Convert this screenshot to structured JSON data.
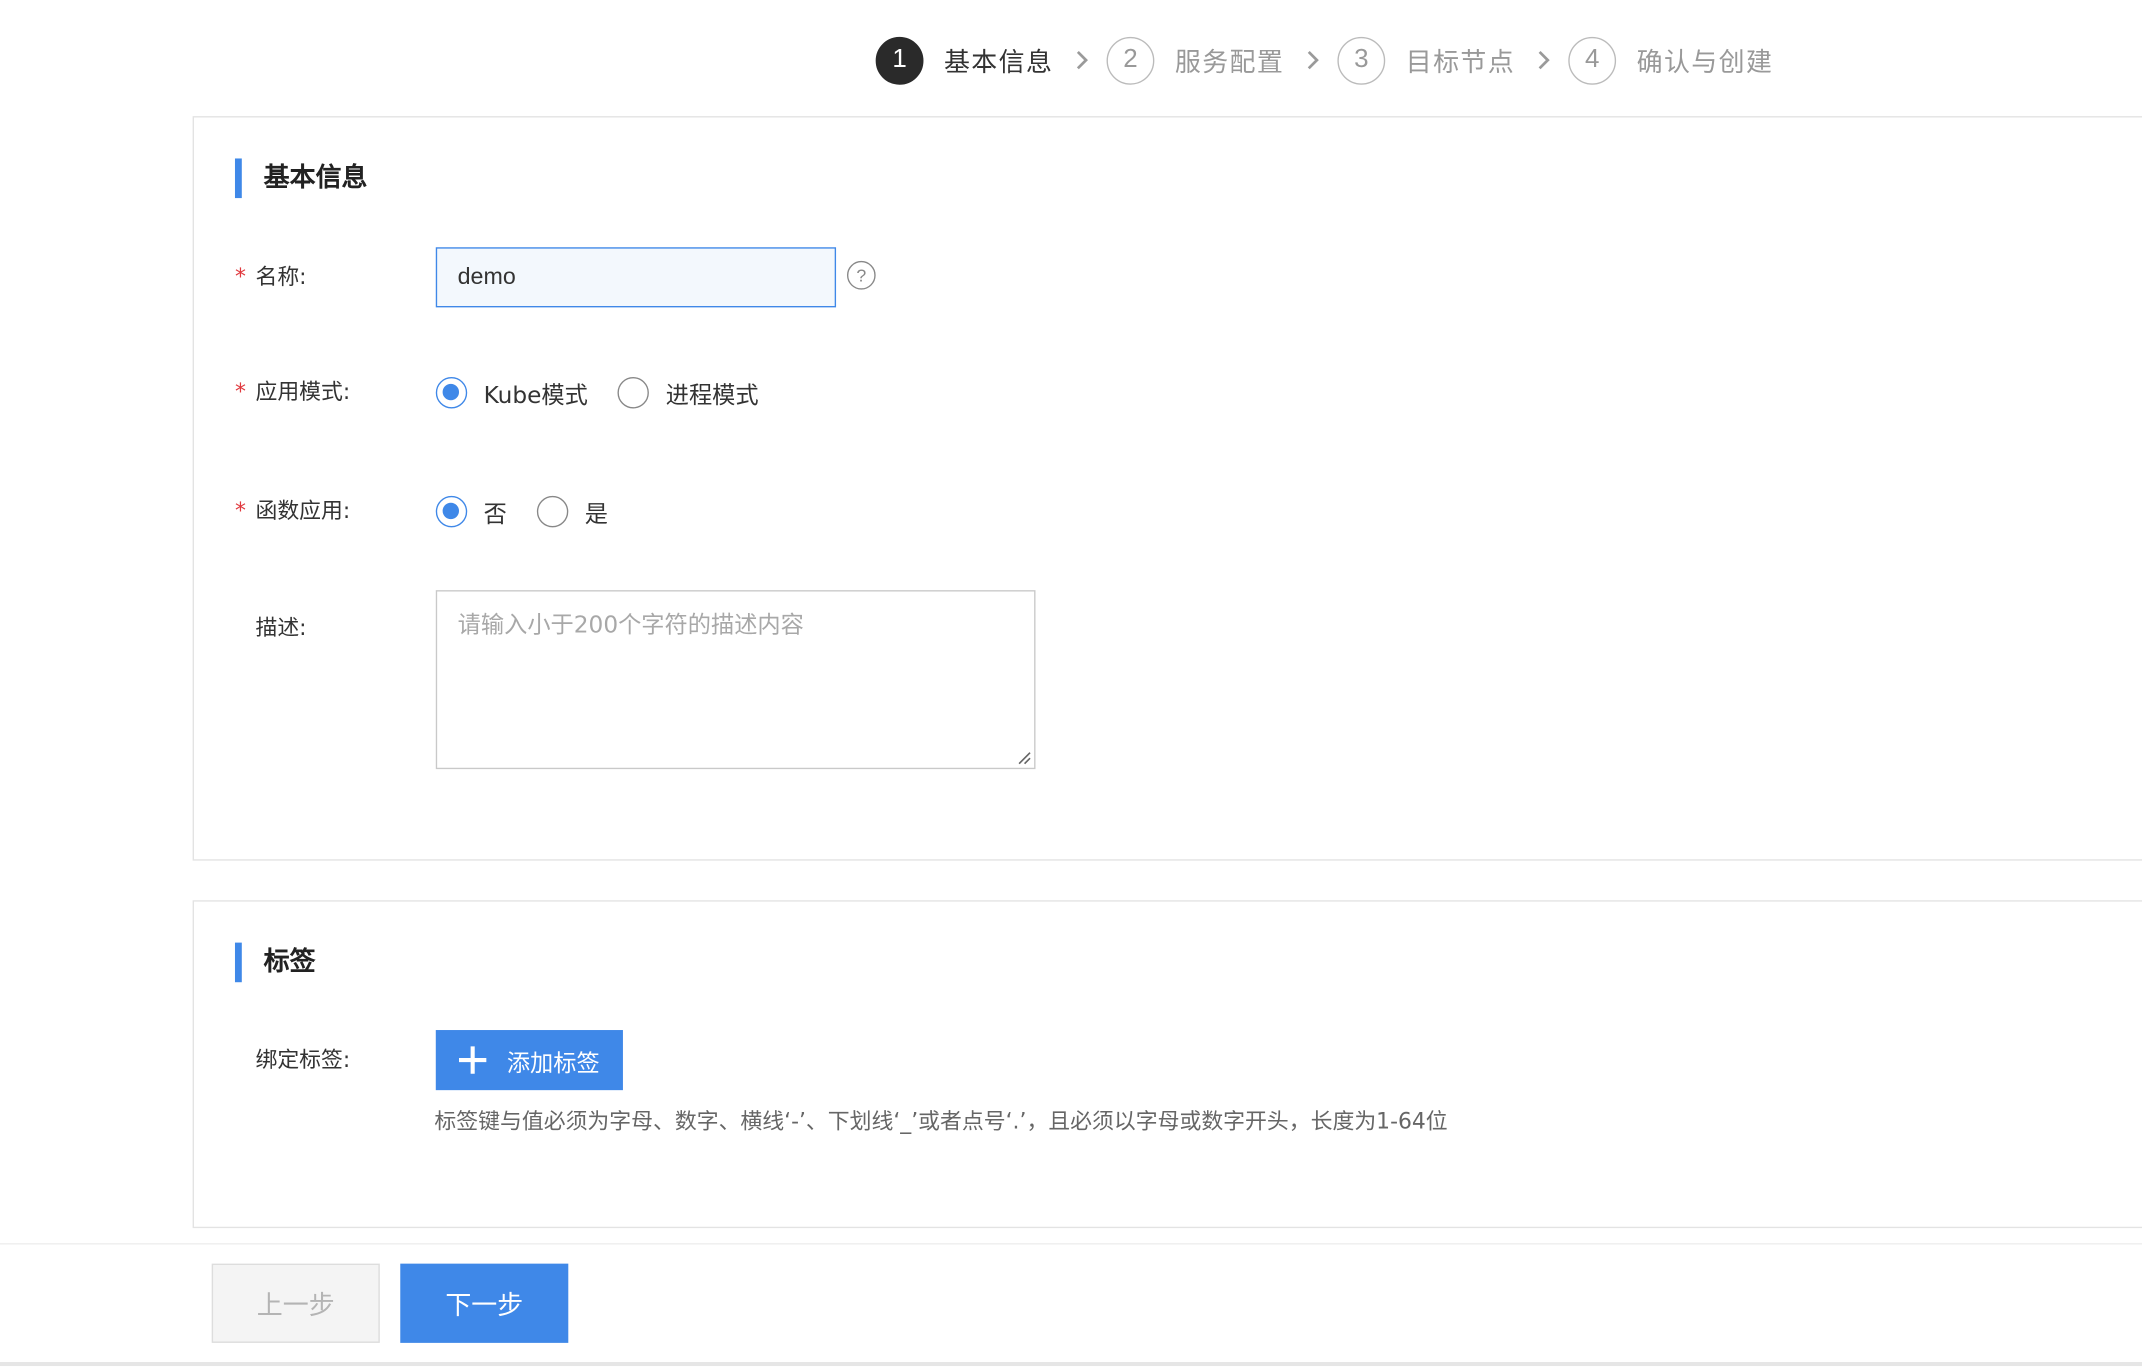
{
  "steps": [
    {
      "num": "1",
      "label": "基本信息",
      "active": true
    },
    {
      "num": "2",
      "label": "服务配置",
      "active": false
    },
    {
      "num": "3",
      "label": "目标节点",
      "active": false
    },
    {
      "num": "4",
      "label": "确认与创建",
      "active": false
    }
  ],
  "basic": {
    "title": "基本信息",
    "name": {
      "required_mark": "*",
      "label": "名称:",
      "value": "demo",
      "help_icon": "question-circle-icon",
      "help_glyph": "?"
    },
    "mode": {
      "required_mark": "*",
      "label": "应用模式:",
      "options": [
        {
          "label": "Kube模式",
          "checked": true
        },
        {
          "label": "进程模式",
          "checked": false
        }
      ]
    },
    "function": {
      "required_mark": "*",
      "label": "函数应用:",
      "options": [
        {
          "label": "否",
          "checked": true
        },
        {
          "label": "是",
          "checked": false
        }
      ]
    },
    "description": {
      "label": "描述:",
      "placeholder": "请输入小于200个字符的描述内容"
    }
  },
  "tags": {
    "title": "标签",
    "bind_label": "绑定标签:",
    "add_button": "添加标签",
    "hint": "标签键与值必须为字母、数字、横线‘-’、下划线‘_’或者点号‘.’，且必须以字母或数字开头，长度为1-64位"
  },
  "footer": {
    "prev_label": "上一步",
    "next_label": "下一步"
  },
  "colors": {
    "accent": "#3f88e8",
    "required": "#e0393e",
    "step_active": "#2a2a2a"
  }
}
